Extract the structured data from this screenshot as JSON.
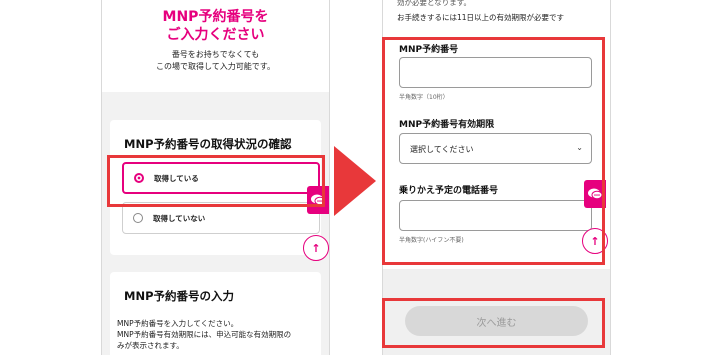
{
  "left": {
    "title_line1": "MNP予約番号を",
    "title_line2": "ご入力ください",
    "sub_line1": "番号をお持ちでなくても",
    "sub_line2": "この場で取得して入力可能です。",
    "status_heading": "MNP予約番号の取得状況の確認",
    "option_have": "取得している",
    "option_not_have": "取得していない",
    "input_heading": "MNP予約番号の入力",
    "body_line1": "MNP予約番号を入力してください。",
    "body_line2": "MNP予約番号有効期限には、申込可能な有効期限の",
    "body_line3": "みが表示されます。"
  },
  "right": {
    "top_line1": "効が必要となります。",
    "top_line2": "お手続きするには11日以上の有効期限が必要です",
    "mnp_number_label": "MNP予約番号",
    "mnp_number_hint": "半角数字（10桁）",
    "expiry_label": "MNP予約番号有効期限",
    "expiry_select_value": "選択してください",
    "phone_label": "乗りかえ予定の電話番号",
    "phone_hint": "半角数字(ハイフン不要)",
    "next_button": "次へ進む"
  },
  "icons": {
    "up_arrow": "↑",
    "chevron_down": "⌄"
  },
  "colors": {
    "accent": "#e6007e",
    "highlight": "#e8383a"
  }
}
